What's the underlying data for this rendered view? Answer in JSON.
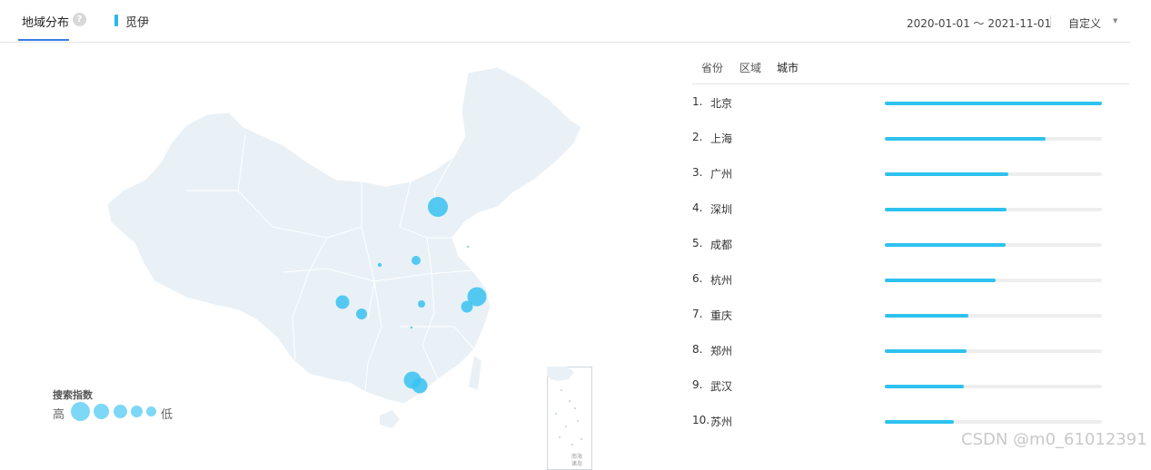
{
  "header": {
    "tab_label": "地域分布",
    "help_icon": "question-icon",
    "help_text": "?",
    "keyword": "觅伊",
    "date_range": "2020-01-01 ～ 2021-11-01",
    "custom_label": "自定义",
    "caret_text": "▼"
  },
  "legend": {
    "title": "搜索指数",
    "high": "高",
    "low": "低"
  },
  "map": {
    "land_color": "#e9f1f6",
    "bubble_color": "#3dc3f1",
    "inset_labels": [
      "南海",
      "诸岛"
    ]
  },
  "ranking": {
    "tabs": [
      "省份",
      "区域",
      "城市"
    ],
    "active_tab": "城市",
    "items": [
      {
        "rank": "1.",
        "name": "北京",
        "value": 1.0
      },
      {
        "rank": "2.",
        "name": "上海",
        "value": 0.74
      },
      {
        "rank": "3.",
        "name": "广州",
        "value": 0.57
      },
      {
        "rank": "4.",
        "name": "深圳",
        "value": 0.56
      },
      {
        "rank": "5.",
        "name": "成都",
        "value": 0.555
      },
      {
        "rank": "6.",
        "name": "杭州",
        "value": 0.51
      },
      {
        "rank": "7.",
        "name": "重庆",
        "value": 0.385
      },
      {
        "rank": "8.",
        "name": "郑州",
        "value": 0.375
      },
      {
        "rank": "9.",
        "name": "武汉",
        "value": 0.365
      },
      {
        "rank": "10.",
        "name": "苏州",
        "value": 0.32
      }
    ]
  },
  "watermark": "CSDN @m0_61012391"
}
